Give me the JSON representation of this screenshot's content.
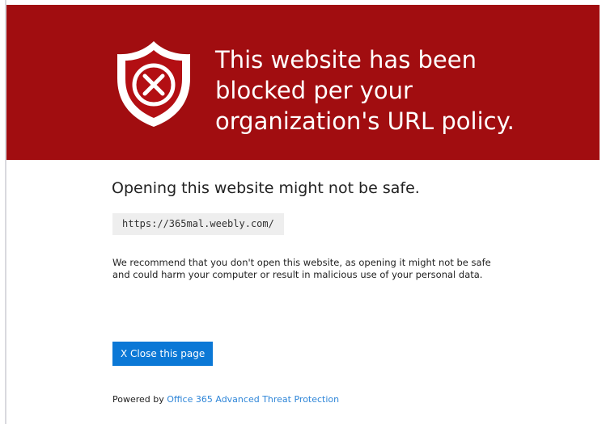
{
  "header": {
    "headline_lines": [
      "This website has been",
      "blocked per your",
      "organization's URL policy."
    ],
    "icon": "shield-x-icon",
    "background_color": "#a10d10"
  },
  "content": {
    "subtitle": "Opening this website might not be safe.",
    "blocked_url": "https://365mal.weebly.com/",
    "description": "We recommend that you don't open this website, as opening it might not be safe and could harm your computer or result in malicious use of your personal data.",
    "close_button_label": "X Close this page",
    "button_color": "#0b78d6"
  },
  "footer": {
    "prefix": "Powered by",
    "link_text": "Office 365 Advanced Threat Protection",
    "link_color": "#2f86d8"
  }
}
